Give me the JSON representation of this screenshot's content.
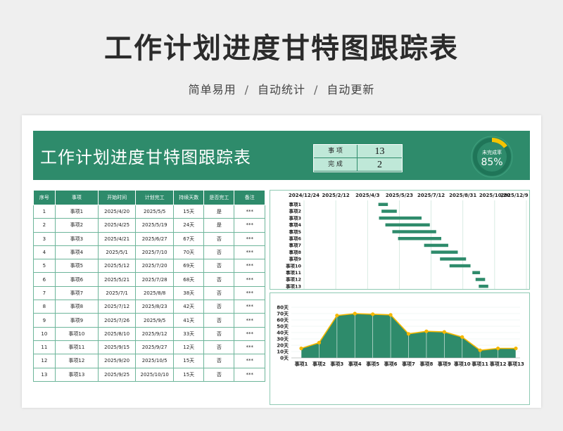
{
  "header": {
    "title": "工作计划进度甘特图跟踪表",
    "subtitle_items": [
      "简单易用",
      "自动统计",
      "自动更新"
    ],
    "separator": "/"
  },
  "sheet": {
    "title": "工作计划进度甘特图跟踪表",
    "stats": [
      {
        "label": "事  项",
        "value": "13"
      },
      {
        "label": "完  成",
        "value": "2"
      }
    ],
    "donut": {
      "label": "未完成率",
      "value": "85%",
      "fraction": 0.85,
      "track_color": "#1f7558",
      "accent_color": "#f5c400"
    }
  },
  "table": {
    "columns": [
      "序号",
      "事项",
      "开始时间",
      "计划完工",
      "持续天数",
      "是否完工",
      "备注"
    ],
    "rows": [
      [
        "1",
        "事项1",
        "2025/4/20",
        "2025/5/5",
        "15天",
        "是",
        "***"
      ],
      [
        "2",
        "事项2",
        "2025/4/25",
        "2025/5/19",
        "24天",
        "是",
        "***"
      ],
      [
        "3",
        "事项3",
        "2025/4/21",
        "2025/6/27",
        "67天",
        "否",
        "***"
      ],
      [
        "4",
        "事项4",
        "2025/5/1",
        "2025/7/10",
        "70天",
        "否",
        "***"
      ],
      [
        "5",
        "事项5",
        "2025/5/12",
        "2025/7/20",
        "69天",
        "否",
        "***"
      ],
      [
        "6",
        "事项6",
        "2025/5/21",
        "2025/7/28",
        "68天",
        "否",
        "***"
      ],
      [
        "7",
        "事项7",
        "2025/7/1",
        "2025/8/8",
        "38天",
        "否",
        "***"
      ],
      [
        "8",
        "事项8",
        "2025/7/12",
        "2025/8/23",
        "42天",
        "否",
        "***"
      ],
      [
        "9",
        "事项9",
        "2025/7/26",
        "2025/9/5",
        "41天",
        "否",
        "***"
      ],
      [
        "10",
        "事项10",
        "2025/8/10",
        "2025/9/12",
        "33天",
        "否",
        "***"
      ],
      [
        "11",
        "事项11",
        "2025/9/15",
        "2025/9/27",
        "12天",
        "否",
        "***"
      ],
      [
        "12",
        "事项12",
        "2025/9/20",
        "2025/10/5",
        "15天",
        "否",
        "***"
      ],
      [
        "13",
        "事项13",
        "2025/9/25",
        "2025/10/10",
        "15天",
        "否",
        "***"
      ]
    ]
  },
  "chart_data": [
    {
      "type": "bar",
      "subtype": "gantt",
      "x_ticks": [
        "2024/12/24",
        "2025/2/12",
        "2025/4/3",
        "2025/5/23",
        "2025/7/12",
        "2025/8/31",
        "2025/10/20",
        "2025/12/9"
      ],
      "xlim": [
        "2024/12/24",
        "2025/12/9"
      ],
      "grid": true,
      "bar_color": "#2e8b6b",
      "tasks": [
        {
          "name": "事项1",
          "start": "2025/4/20",
          "end": "2025/5/5"
        },
        {
          "name": "事项2",
          "start": "2025/4/25",
          "end": "2025/5/19"
        },
        {
          "name": "事项3",
          "start": "2025/4/21",
          "end": "2025/6/27"
        },
        {
          "name": "事项4",
          "start": "2025/5/1",
          "end": "2025/7/10"
        },
        {
          "name": "事项5",
          "start": "2025/5/12",
          "end": "2025/7/20"
        },
        {
          "name": "事项6",
          "start": "2025/5/21",
          "end": "2025/7/28"
        },
        {
          "name": "事项7",
          "start": "2025/7/1",
          "end": "2025/8/8"
        },
        {
          "name": "事项8",
          "start": "2025/7/12",
          "end": "2025/8/23"
        },
        {
          "name": "事项9",
          "start": "2025/7/26",
          "end": "2025/9/5"
        },
        {
          "name": "事项10",
          "start": "2025/8/10",
          "end": "2025/9/12"
        },
        {
          "name": "事项11",
          "start": "2025/9/15",
          "end": "2025/9/27"
        },
        {
          "name": "事项12",
          "start": "2025/9/20",
          "end": "2025/10/5"
        },
        {
          "name": "事项13",
          "start": "2025/9/25",
          "end": "2025/10/10"
        }
      ]
    },
    {
      "type": "area",
      "categories": [
        "事项1",
        "事项2",
        "事项3",
        "事项4",
        "事项5",
        "事项6",
        "事项7",
        "事项8",
        "事项9",
        "事项10",
        "事项11",
        "事项12",
        "事项13"
      ],
      "values": [
        15,
        24,
        67,
        70,
        69,
        68,
        38,
        42,
        41,
        33,
        12,
        15,
        15
      ],
      "ylim": [
        0,
        80
      ],
      "y_ticks": [
        "0天",
        "10天",
        "20天",
        "30天",
        "40天",
        "50天",
        "60天",
        "70天",
        "80天"
      ],
      "fill_color": "#2e8b6b",
      "line_color": "#f5b800",
      "grid": true
    }
  ]
}
